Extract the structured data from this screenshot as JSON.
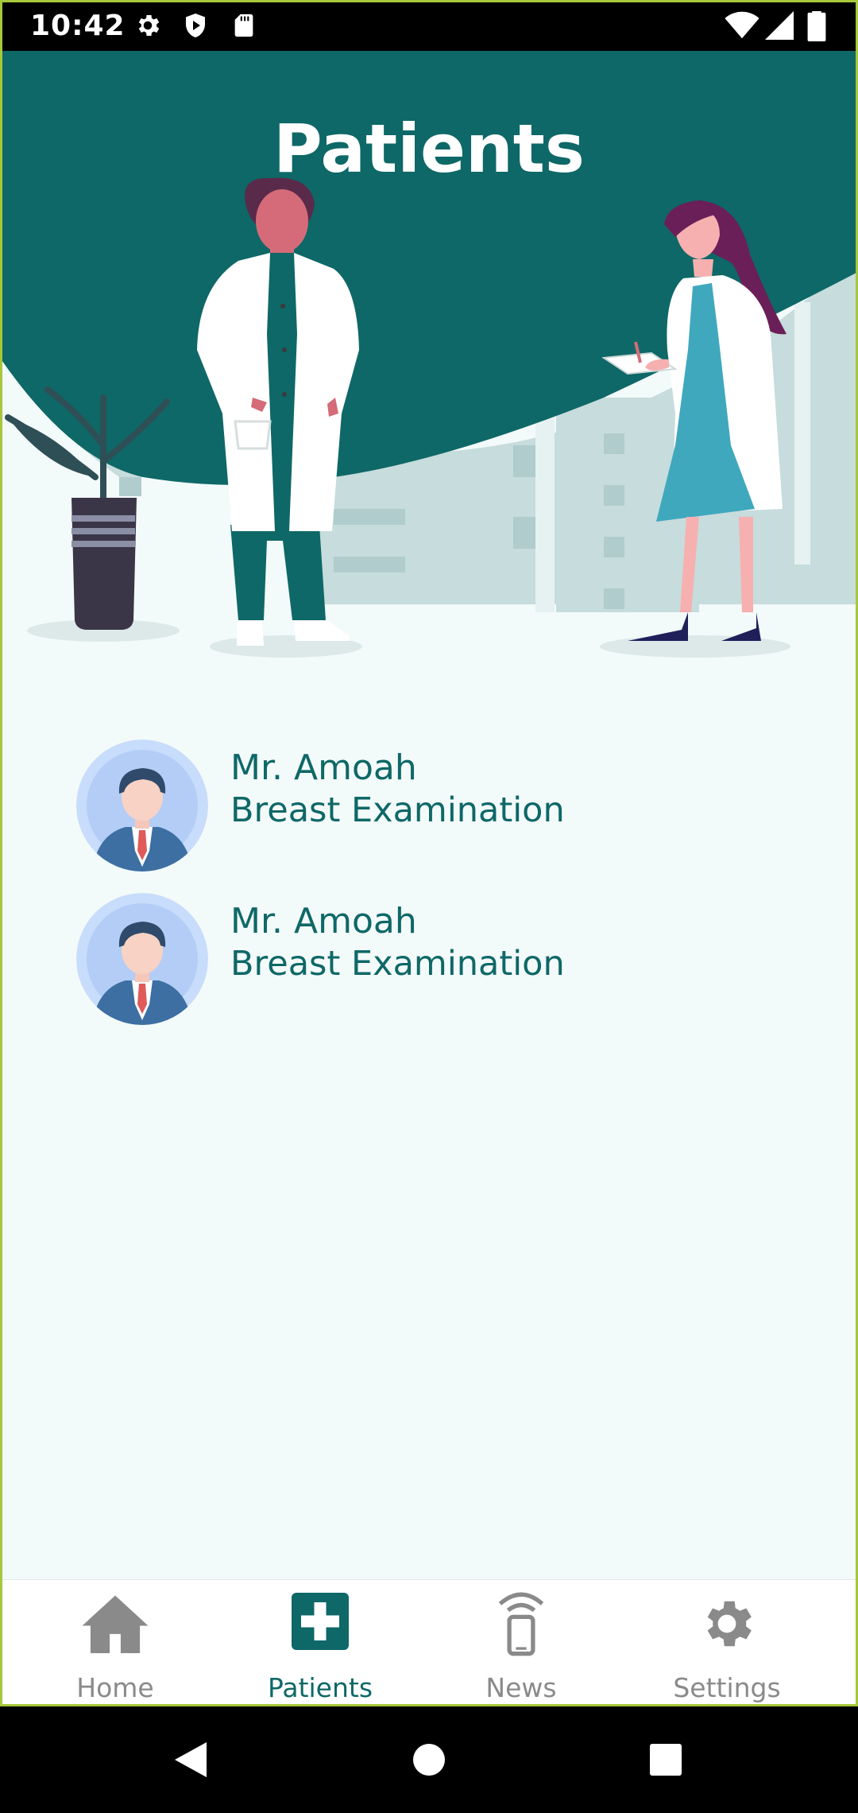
{
  "status_bar": {
    "time": "10:42",
    "icons": [
      "gear-icon",
      "shield-play-icon",
      "sd-card-icon",
      "wifi-icon",
      "signal-icon",
      "battery-icon"
    ]
  },
  "header": {
    "title": "Patients"
  },
  "patients": [
    {
      "name": "Mr. Amoah",
      "exam": "Breast Examination"
    },
    {
      "name": "Mr. Amoah",
      "exam": "Breast Examination"
    }
  ],
  "bottom_nav": {
    "items": [
      {
        "label": "Home",
        "icon": "home-icon",
        "active": false
      },
      {
        "label": "Patients",
        "icon": "medical-cross-icon",
        "active": true
      },
      {
        "label": "News",
        "icon": "phone-signal-icon",
        "active": false
      },
      {
        "label": "Settings",
        "icon": "gear-icon",
        "active": false
      }
    ]
  },
  "colors": {
    "primary": "#0e6867",
    "background": "#f3fafa",
    "inactive": "#8a8a8a"
  },
  "system_nav": {
    "icons": [
      "back-icon",
      "home-circle-icon",
      "recents-icon"
    ]
  }
}
